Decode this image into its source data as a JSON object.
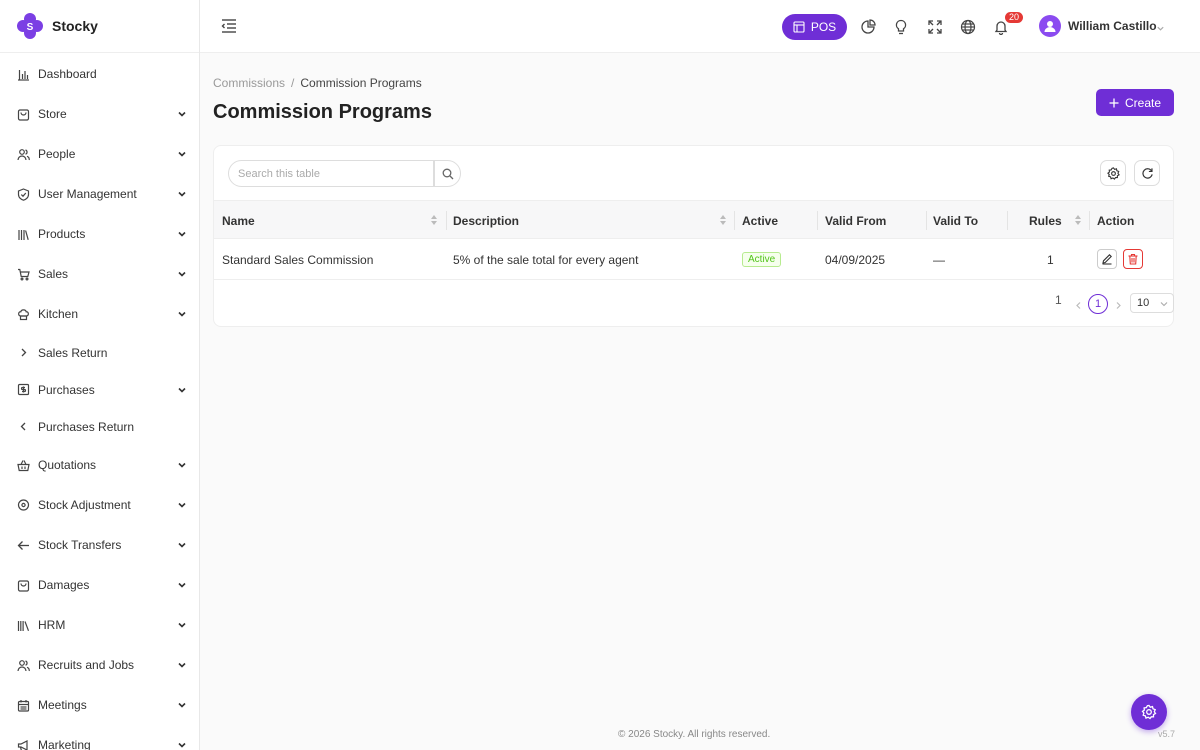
{
  "brand": {
    "name": "Stocky"
  },
  "sidebar": {
    "items": [
      {
        "label": "Dashboard",
        "icon": "bar-chart-icon",
        "chevron": "none"
      },
      {
        "label": "Store",
        "icon": "shopping-bag-icon",
        "chevron": "down"
      },
      {
        "label": "People",
        "icon": "users-icon",
        "chevron": "down"
      },
      {
        "label": "User Management",
        "icon": "shield-icon",
        "chevron": "down"
      },
      {
        "label": "Products",
        "icon": "books-icon",
        "chevron": "down"
      },
      {
        "label": "Sales",
        "icon": "cart-icon",
        "chevron": "down"
      },
      {
        "label": "Kitchen",
        "icon": "chef-hat-icon",
        "chevron": "down"
      },
      {
        "label": "Sales Return",
        "icon": "chevron-right-icon",
        "chevron": "none"
      },
      {
        "label": "Purchases",
        "icon": "dollar-receipt-icon",
        "chevron": "down"
      },
      {
        "label": "Purchases Return",
        "icon": "chevron-left-icon",
        "chevron": "none"
      },
      {
        "label": "Quotations",
        "icon": "basket-icon",
        "chevron": "down"
      },
      {
        "label": "Stock Adjustment",
        "icon": "map-pin-icon",
        "chevron": "down"
      },
      {
        "label": "Stock Transfers",
        "icon": "arrow-left-icon",
        "chevron": "down"
      },
      {
        "label": "Damages",
        "icon": "shopping-bag-icon",
        "chevron": "down"
      },
      {
        "label": "HRM",
        "icon": "library-icon",
        "chevron": "down"
      },
      {
        "label": "Recruits and Jobs",
        "icon": "users-icon",
        "chevron": "down"
      },
      {
        "label": "Meetings",
        "icon": "calendar-icon",
        "chevron": "down"
      },
      {
        "label": "Marketing",
        "icon": "megaphone-icon",
        "chevron": "down"
      }
    ]
  },
  "header": {
    "pos_label": "POS",
    "notification_count": "20",
    "user_name": "William Castillo"
  },
  "breadcrumb": {
    "parent": "Commissions",
    "separator": "/",
    "current": "Commission Programs"
  },
  "page": {
    "title": "Commission Programs",
    "create_label": "Create"
  },
  "table": {
    "search_placeholder": "Search this table",
    "columns": {
      "name": "Name",
      "description": "Description",
      "active": "Active",
      "valid_from": "Valid From",
      "valid_to": "Valid To",
      "rules": "Rules",
      "action": "Action"
    },
    "rows": [
      {
        "name": "Standard Sales Commission",
        "description": "5% of the sale total for every agent",
        "active": "Active",
        "valid_from": "04/09/2025",
        "valid_to": "—",
        "rules": "1"
      }
    ]
  },
  "pagination": {
    "total": "1",
    "current_page": "1",
    "page_size": "10"
  },
  "footer": {
    "copyright": "© 2026 Stocky. All rights reserved.",
    "version": "v5.7"
  },
  "colors": {
    "accent": "#6f2ed6",
    "danger": "#e53935",
    "success": "#52c41a"
  }
}
